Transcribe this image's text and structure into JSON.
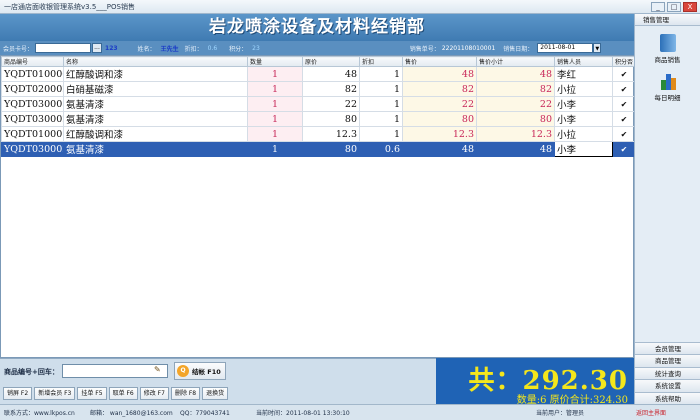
{
  "window": {
    "title": "一店通店面收银管理系统v3.5___POS销售",
    "min": "_",
    "max": "□",
    "close": "X"
  },
  "banner": {
    "title": "岩龙喷涂设备及材料经销部"
  },
  "info": {
    "card_label": "会员卡号：",
    "card_value": "",
    "dots": "...",
    "points_num": "123",
    "name_label": "姓名：",
    "name_value": "王先生",
    "discount_label": "折扣：",
    "discount_value": "0.6",
    "score_label": "积分：",
    "score_value": "23",
    "order_label": "销售单号：",
    "order_value": "22201108010001",
    "date_label": "销售日期：",
    "date_value": "2011-08-01",
    "date_arrow": "▼"
  },
  "table": {
    "headers": [
      "商品编号",
      "名称",
      "数量",
      "原价",
      "折扣",
      "售价",
      "售价小计",
      "销售人员",
      "积分否"
    ],
    "rows": [
      {
        "code": "YQDT010006",
        "name": "红醇酸调和漆",
        "qty": "1",
        "orig": "48",
        "disc": "1",
        "price": "48",
        "subtotal": "48",
        "seller": "李红",
        "check": "✔"
      },
      {
        "code": "YQDT020002",
        "name": "白硝基磁漆",
        "qty": "1",
        "orig": "82",
        "disc": "1",
        "price": "82",
        "subtotal": "82",
        "seller": "小拉",
        "check": "✔"
      },
      {
        "code": "YQDT030003",
        "name": "氨基清漆",
        "qty": "1",
        "orig": "22",
        "disc": "1",
        "price": "22",
        "subtotal": "22",
        "seller": "小李",
        "check": "✔"
      },
      {
        "code": "YQDT030002",
        "name": "氨基清漆",
        "qty": "1",
        "orig": "80",
        "disc": "1",
        "price": "80",
        "subtotal": "80",
        "seller": "小李",
        "check": "✔"
      },
      {
        "code": "YQDT010005",
        "name": "红醇酸调和漆",
        "qty": "1",
        "orig": "12.3",
        "disc": "1",
        "price": "12.3",
        "subtotal": "12.3",
        "seller": "小拉",
        "check": "✔"
      },
      {
        "code": "YQDT030002",
        "name": "氨基清漆",
        "qty": "1",
        "orig": "80",
        "disc": "0.6",
        "price": "48",
        "subtotal": "48",
        "seller": "小李",
        "check": "✔"
      }
    ]
  },
  "bottom": {
    "code_label": "商品编号+回车：",
    "pay_label": "结帐 F10",
    "coin": "Q",
    "fkeys": [
      "销屏 F2",
      "新增会员 F3",
      "挂单 F5",
      "取单 F6",
      "修改 F7",
      "删除 F8",
      "退换货"
    ]
  },
  "total": {
    "big": "共：292.30",
    "small": "数量:6  原价合计:324.30"
  },
  "status": {
    "contact": "联系方式：www.lkpos.cn",
    "email": "邮箱：  wan_1680@163.com",
    "qq": "QQ：779043741",
    "time": "当前时间：2011-08-01 13:30:10",
    "user": "当前用户：管理员",
    "back": "返回主界面"
  },
  "sidebar": {
    "header": "销售管理",
    "sales_label": "商品销售",
    "daily_label": "每日明细",
    "menu": [
      "会员管理",
      "商品管理",
      "统计查询",
      "系统设置",
      "系统帮助"
    ]
  }
}
